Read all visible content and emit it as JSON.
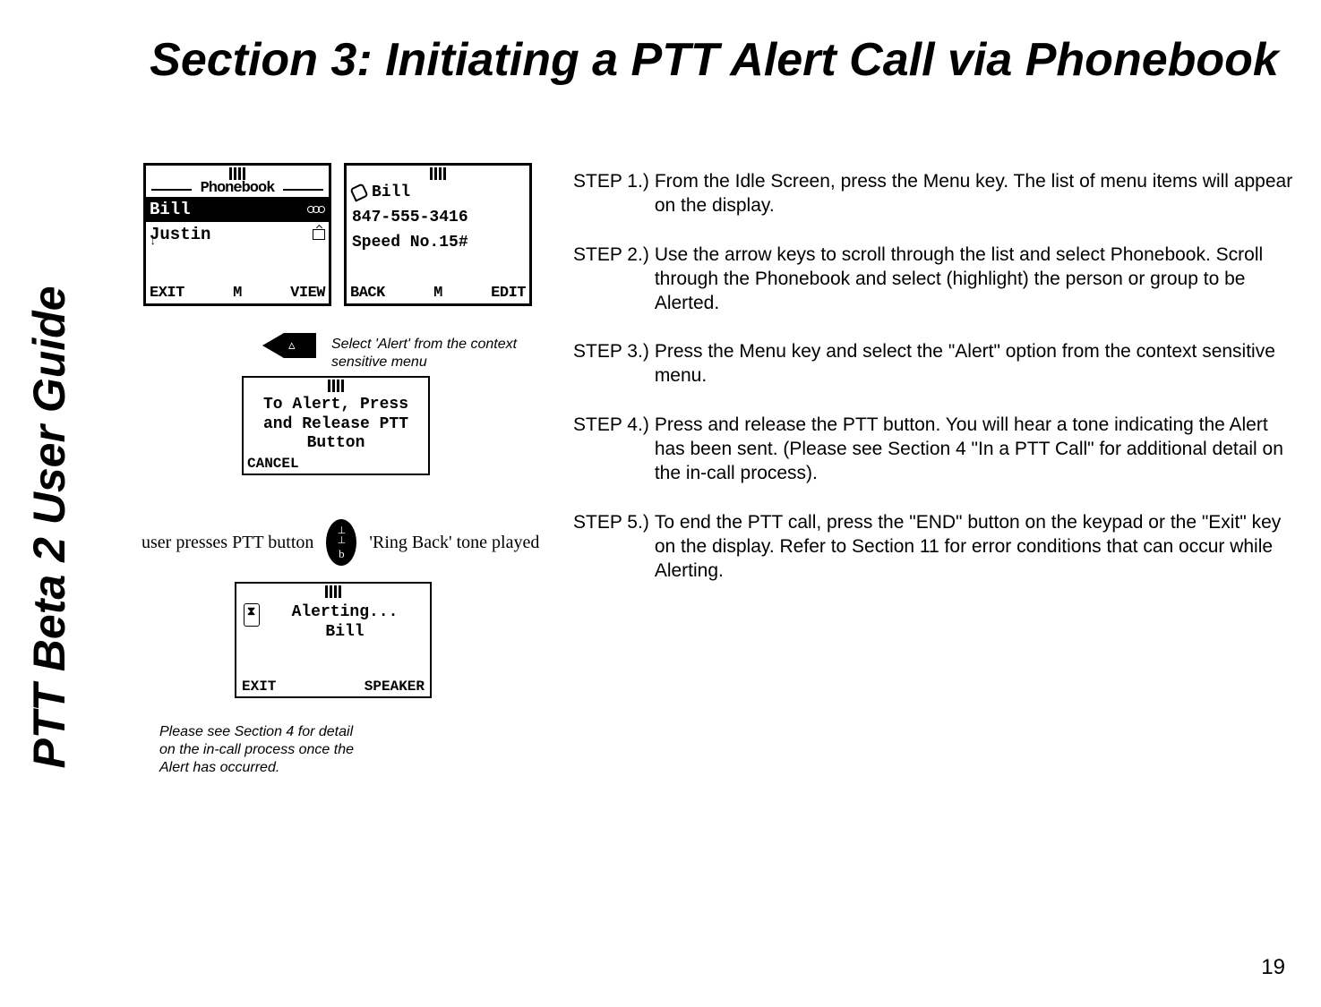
{
  "sidebar_title": "PTT Beta 2 User Guide",
  "main_title": "Section 3: Initiating a PTT Alert Call via Phonebook",
  "phonebook_screen": {
    "header": "Phonebook",
    "selected_name": "Bill",
    "second_name": "Justin",
    "softkeys": {
      "left": "EXIT",
      "mid": "M",
      "right": "VIEW"
    }
  },
  "detail_screen": {
    "name": "Bill",
    "number": "847-555-3416",
    "speed": "Speed No.15#",
    "softkeys": {
      "left": "BACK",
      "mid": "M",
      "right": "EDIT"
    }
  },
  "context_note": "Select 'Alert' from the context sensitive menu",
  "alert_prompt": {
    "line1": "To Alert, Press",
    "line2": "and Release PTT",
    "line3": "Button",
    "cancel": "CANCEL"
  },
  "ptt_left": "user presses PTT button",
  "ptt_right": "'Ring Back' tone played",
  "alerting_screen": {
    "line1": "Alerting...",
    "line2": "Bill",
    "softkeys": {
      "left": "EXIT",
      "right": "SPEAKER"
    }
  },
  "footnote": "Please see Section 4 for detail on the in-call process once the Alert has occurred.",
  "steps": [
    {
      "label": "STEP 1.)",
      "body": "From the Idle Screen, press the Menu key.  The list of menu items will appear on the display."
    },
    {
      "label": "STEP 2.)",
      "body": "Use the arrow keys to scroll through the list and select Phonebook.  Scroll through the Phonebook and select (highlight) the person or group to be Alerted."
    },
    {
      "label": "STEP 3.)",
      "body": "Press the Menu key and select the \"Alert\" option from the context sensitive menu."
    },
    {
      "label": "STEP 4.)",
      "body": "Press and release the PTT button.  You will hear a tone indicating the Alert has been sent.  (Please see Section 4 \"In a PTT Call\" for additional detail on the in-call process)."
    },
    {
      "label": "STEP 5.)",
      "body": "To end the PTT call, press the \"END\" button on the keypad or the \"Exit\" key on the display.  Refer to Section 11 for error conditions that can occur while Alerting."
    }
  ],
  "page_number": "19"
}
